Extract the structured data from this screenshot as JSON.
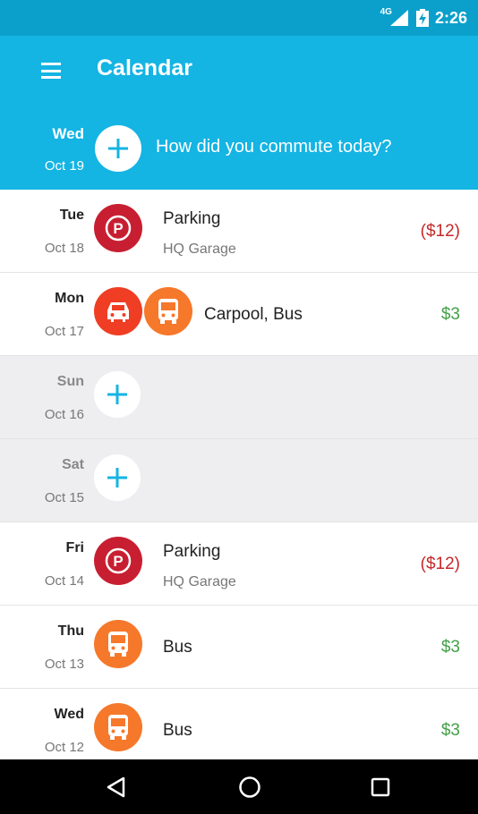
{
  "status_bar": {
    "network": "4G",
    "time": "2:26"
  },
  "app_bar": {
    "title": "Calendar"
  },
  "today": {
    "dow": "Wed",
    "date": "Oct 19",
    "prompt": "How did you commute today?"
  },
  "days": [
    {
      "dow": "Tue",
      "date": "Oct 18",
      "title": "Parking",
      "subtitle": "HQ Garage",
      "amount": "($12)"
    },
    {
      "dow": "Mon",
      "date": "Oct 17",
      "title": "Carpool, Bus",
      "amount": "$3"
    },
    {
      "dow": "Sun",
      "date": "Oct 16"
    },
    {
      "dow": "Sat",
      "date": "Oct 15"
    },
    {
      "dow": "Fri",
      "date": "Oct 14",
      "title": "Parking",
      "subtitle": "HQ Garage",
      "amount": "($12)"
    },
    {
      "dow": "Thu",
      "date": "Oct 13",
      "title": "Bus",
      "amount": "$3"
    },
    {
      "dow": "Wed",
      "date": "Oct 12",
      "title": "Bus",
      "amount": "$3"
    }
  ],
  "colors": {
    "status_bar": "#0ba0cc",
    "app_bar": "#14b4e3",
    "parking": "#c71f31",
    "bus": "#f6782b",
    "carpool": "#ef3e24",
    "cost": "#c62828",
    "savings": "#43a047"
  },
  "icons": {
    "parking": "parking-icon",
    "bus": "bus-icon",
    "carpool": "car-icon",
    "add": "plus-icon"
  }
}
